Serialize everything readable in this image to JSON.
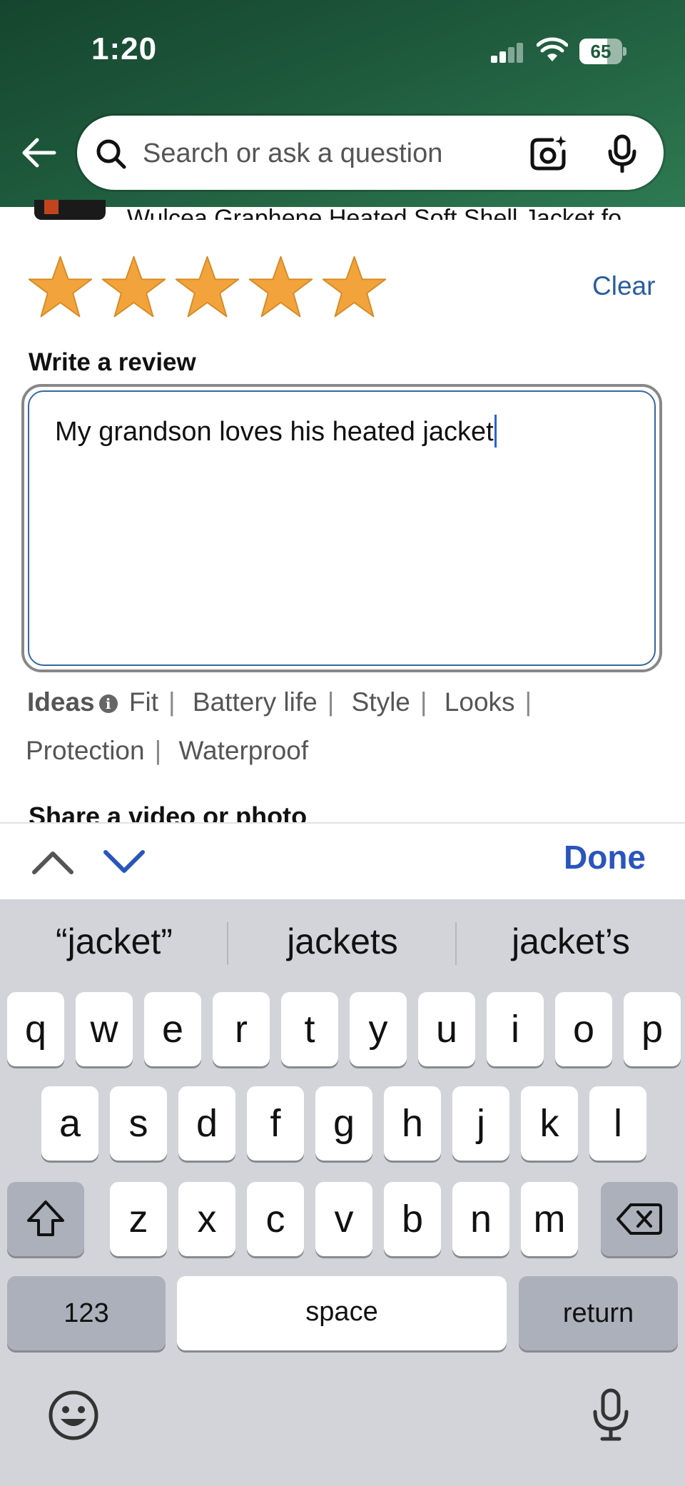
{
  "status": {
    "time": "1:20",
    "battery": "65"
  },
  "search": {
    "placeholder": "Search or ask a question"
  },
  "product": {
    "title": "Wulcea Graphene Heated Soft Shell Jacket fo..."
  },
  "rating": {
    "stars": 5,
    "max_stars": 5,
    "clear_label": "Clear",
    "star_color": "#f3a33c"
  },
  "review": {
    "label": "Write a review",
    "text": "My grandson loves his heated jacket"
  },
  "ideas": {
    "label": "Ideas",
    "chips": [
      "Fit",
      "Battery life",
      "Style",
      "Looks",
      "Protection",
      "Waterproof"
    ]
  },
  "share": {
    "label": "Share a video or photo"
  },
  "toolbar": {
    "done_label": "Done"
  },
  "keyboard": {
    "suggestions": [
      "“jacket”",
      "jackets",
      "jacket’s"
    ],
    "row1": [
      "q",
      "w",
      "e",
      "r",
      "t",
      "y",
      "u",
      "i",
      "o",
      "p"
    ],
    "row2": [
      "a",
      "s",
      "d",
      "f",
      "g",
      "h",
      "j",
      "k",
      "l"
    ],
    "row3": [
      "z",
      "x",
      "c",
      "v",
      "b",
      "n",
      "m"
    ],
    "numbers_label": "123",
    "space_label": "space",
    "return_label": "return"
  },
  "colors": {
    "header_dark": "#15452e",
    "header_light": "#2e7a52",
    "link": "#2a5d9e",
    "done": "#2a55bd"
  },
  "icons": [
    "back-arrow-icon",
    "search-icon",
    "camera-icon",
    "microphone-icon",
    "star-icon",
    "info-icon",
    "chevron-up-icon",
    "chevron-down-icon",
    "shift-icon",
    "delete-icon",
    "emoji-icon",
    "dictation-icon"
  ]
}
